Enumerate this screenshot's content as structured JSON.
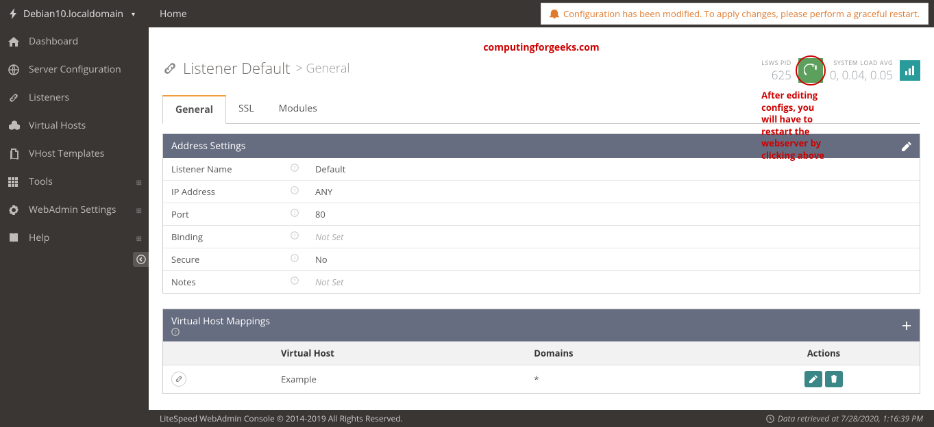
{
  "host": "Debian10.localdomain",
  "breadcrumb": "Home",
  "notification": "Configuration has been modified. To apply changes, please perform a graceful restart.",
  "watermark": "computingforgeeks.com",
  "page_title_prefix": "Listener Default",
  "page_title_suffix": "> General",
  "annotation": "After editing configs, you\nwill have to restart the\nwebserver by clicking above",
  "stats": {
    "pid_label": "LSWS PID",
    "pid_value": "625",
    "load_label": "SYSTEM LOAD AVG",
    "load_value": "0, 0.04, 0.05"
  },
  "sidebar": [
    {
      "icon": "home",
      "label": "Dashboard",
      "expand": false
    },
    {
      "icon": "globe",
      "label": "Server Configuration",
      "expand": false
    },
    {
      "icon": "link",
      "label": "Listeners",
      "expand": false
    },
    {
      "icon": "cubes",
      "label": "Virtual Hosts",
      "expand": false
    },
    {
      "icon": "copy",
      "label": "VHost Templates",
      "expand": false
    },
    {
      "icon": "grid",
      "label": "Tools",
      "expand": true
    },
    {
      "icon": "gear",
      "label": "WebAdmin Settings",
      "expand": true
    },
    {
      "icon": "book",
      "label": "Help",
      "expand": true
    }
  ],
  "tabs": [
    {
      "label": "General",
      "active": true
    },
    {
      "label": "SSL",
      "active": false
    },
    {
      "label": "Modules",
      "active": false
    }
  ],
  "address_settings": {
    "title": "Address Settings",
    "rows": [
      {
        "label": "Listener Name",
        "value": "Default",
        "notset": false
      },
      {
        "label": "IP Address",
        "value": "ANY",
        "notset": false
      },
      {
        "label": "Port",
        "value": "80",
        "notset": false
      },
      {
        "label": "Binding",
        "value": "Not Set",
        "notset": true
      },
      {
        "label": "Secure",
        "value": "No",
        "notset": false
      },
      {
        "label": "Notes",
        "value": "Not Set",
        "notset": true
      }
    ]
  },
  "vh_mappings": {
    "title": "Virtual Host Mappings",
    "columns": {
      "c0": "",
      "c1": "Virtual Host",
      "c2": "Domains",
      "c3": "Actions"
    },
    "rows": [
      {
        "vhost": "Example",
        "domains": "*"
      }
    ]
  },
  "footer": {
    "left": "LiteSpeed WebAdmin Console © 2014-2019 All Rights Reserved.",
    "right": "Data retrieved at 7/28/2020, 1:16:39 PM"
  }
}
